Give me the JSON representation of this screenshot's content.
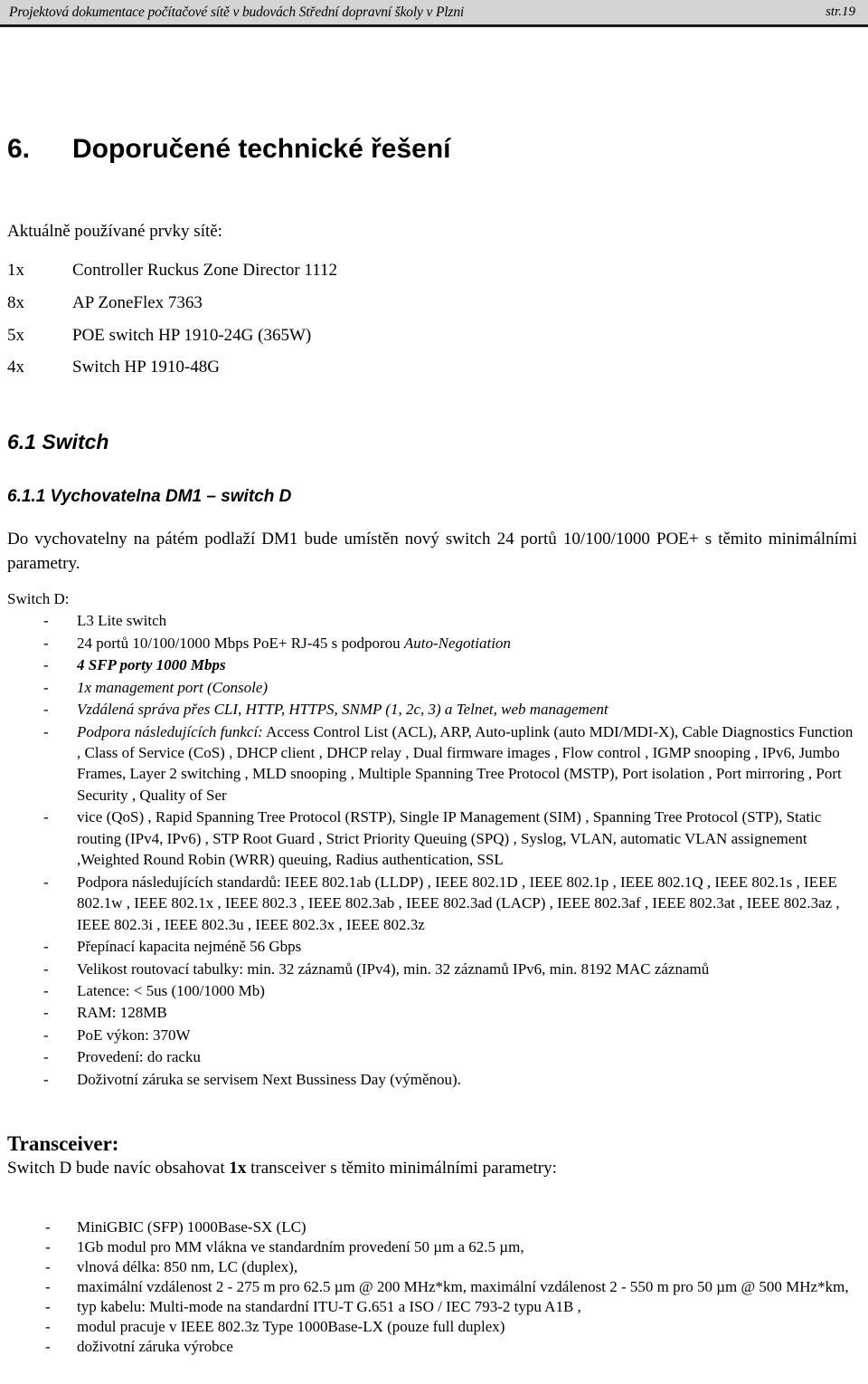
{
  "header": {
    "title": "Projektová dokumentace počítačové sítě v budovách Střední dopravní školy v Plzni",
    "page_label": "str.19"
  },
  "chapter": {
    "number": "6.",
    "title": "Doporučené technické řešení"
  },
  "inventory": {
    "lead": "Aktuálně používané prvky sítě:",
    "rows": [
      {
        "qty": "1x",
        "desc": "Controller Ruckus Zone Director 1112"
      },
      {
        "qty": "8x",
        "desc": "AP ZoneFlex 7363"
      },
      {
        "qty": "5x",
        "desc": "POE switch HP 1910-24G (365W)"
      },
      {
        "qty": "4x",
        "desc": "Switch HP 1910-48G"
      }
    ]
  },
  "section_switch": {
    "heading": "6.1  Switch",
    "subheading": "6.1.1  Vychovatelna DM1 – switch D",
    "paragraph": "Do vychovatelny na pátém podlaží DM1 bude umístěn nový switch 24 portů 10/100/1000 POE+ s těmito minimálními parametry.",
    "list_label": "Switch D:",
    "bullet_dash": "-",
    "items": [
      {
        "id": "l3-lite",
        "style": "plain",
        "text": "L3 Lite switch"
      },
      {
        "id": "ports-24",
        "style": "mixed",
        "lead_plain": "24 portů 10/100/1000 Mbps PoE+ RJ-45 s podporou ",
        "lead_italic": "Auto-Negotiation",
        "text": "24 portů 10/100/1000 Mbps PoE+ RJ-45 s podporou Auto-Negotiation"
      },
      {
        "id": "sfp-ports",
        "style": "bold-italic",
        "text": "4 SFP porty 1000 Mbps"
      },
      {
        "id": "management-port",
        "style": "italic",
        "text": "1x management port (Console)"
      },
      {
        "id": "remote-management",
        "style": "italic",
        "text": "Vzdálená správa přes CLI, HTTP, HTTPS, SNMP (1, 2c, 3) a Telnet, web management"
      },
      {
        "id": "functions",
        "style": "italic-prefix",
        "prefix_italic": "Podpora následujících funkcí:",
        "body": " Access Control List (ACL), ARP, Auto-uplink (auto MDI/MDI-X), Cable Diagnostics Function , Class of Service (CoS) , DHCP client , DHCP relay , Dual firmware images , Flow control , IGMP snooping , IPv6, Jumbo Frames, Layer 2 switching , MLD snooping , Multiple Spanning Tree Protocol (MSTP), Port isolation , Port mirroring , Port Security , Quality of Ser"
      },
      {
        "id": "functions-cont",
        "style": "plain",
        "text": "vice (QoS) , Rapid Spanning Tree Protocol (RSTP), Single IP Management (SIM) , Spanning Tree Protocol (STP), Static routing (IPv4, IPv6) , STP Root Guard , Strict Priority Queuing (SPQ) , Syslog, VLAN, automatic VLAN assignement ,Weighted Round Robin (WRR) queuing, Radius authentication, SSL"
      },
      {
        "id": "standards",
        "style": "plain",
        "text": "Podpora následujících standardů: IEEE 802.1ab (LLDP) , IEEE 802.1D , IEEE 802.1p , IEEE 802.1Q , IEEE 802.1s , IEEE 802.1w , IEEE 802.1x , IEEE 802.3 , IEEE 802.3ab , IEEE 802.3ad (LACP) , IEEE 802.3af , IEEE 802.3at , IEEE 802.3az , IEEE 802.3i , IEEE 802.3u , IEEE 802.3x , IEEE 802.3z"
      },
      {
        "id": "switching-capacity",
        "style": "plain",
        "text": "Přepínací kapacita nejméně 56 Gbps"
      },
      {
        "id": "routing-table",
        "style": "plain",
        "text": "Velikost routovací tabulky: min. 32 záznamů (IPv4), min. 32 záznamů IPv6, min. 8192 MAC záznamů"
      },
      {
        "id": "latency",
        "style": "plain",
        "text": "Latence: < 5us (100/1000 Mb)"
      },
      {
        "id": "ram",
        "style": "plain",
        "text": "RAM: 128MB"
      },
      {
        "id": "poe-power",
        "style": "plain",
        "text": "PoE výkon: 370W"
      },
      {
        "id": "form-factor",
        "style": "plain",
        "text": "Provedení: do racku"
      },
      {
        "id": "warranty",
        "style": "plain",
        "text": "Doživotní záruka se servisem Next Bussiness Day (výměnou)."
      }
    ]
  },
  "section_transceiver": {
    "heading": "Transceiver:",
    "intro_before": "Switch D bude navíc obsahovat ",
    "intro_bold": "1x",
    "intro_after": " transceiver s těmito minimálními parametry:",
    "bullet_dash": "-",
    "items": [
      {
        "id": "minigbic",
        "text": "MiniGBIC (SFP) 1000Base-SX (LC)"
      },
      {
        "id": "module-mm",
        "text": "1Gb modul pro MM vlákna ve standardním provedení 50 µm a 62.5 µm,"
      },
      {
        "id": "wavelength",
        "text": "vlnová délka: 850 nm, LC (duplex),"
      },
      {
        "id": "max-distance",
        "text": "maximální vzdálenost 2 - 275 m pro 62.5 µm @ 200 MHz*km, maximální vzdálenost 2 - 550 m pro 50 µm @ 500 MHz*km,"
      },
      {
        "id": "cable-type",
        "text": "typ kabelu: Multi-mode na standardní ITU-T G.651 a ISO / IEC 793-2 typu A1B ,"
      },
      {
        "id": "standard",
        "text": "modul pracuje v IEEE 802.3z Type 1000Base-LX (pouze full duplex)"
      },
      {
        "id": "warranty",
        "text": "doživotní záruka výrobce"
      }
    ]
  },
  "colors": {
    "header_band": "#d4d4d4",
    "header_rule": "#1a1a1a",
    "text": "#000000",
    "page": "#ffffff"
  }
}
